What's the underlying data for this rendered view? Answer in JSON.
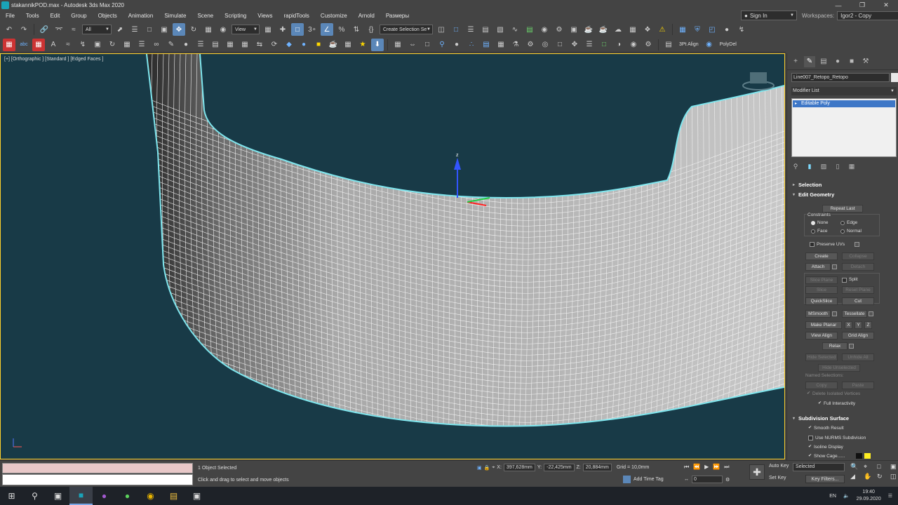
{
  "window": {
    "title": "stakannikPOD.max - Autodesk 3ds Max 2020",
    "controls": [
      "—",
      "❐",
      "✕"
    ]
  },
  "menu": [
    "File",
    "Tools",
    "Edit",
    "Group",
    "Objects",
    "Animation",
    "Simulate",
    "Scene",
    "Scripting",
    "Views",
    "rapidTools",
    "Customize",
    "Arnold",
    "Размеры"
  ],
  "account": {
    "signin": "Sign In",
    "workspaces_label": "Workspaces:",
    "workspace_value": "Igor2 - Copy"
  },
  "toolbar1": {
    "selection_filter": "All",
    "ref_coord": "View",
    "named_selection": "Create Selection Se"
  },
  "toolbar2": {
    "label_3pt": "3Pt Align",
    "label_polydel": "PolyDel"
  },
  "viewport": {
    "label": "[+] [Orthographic ] [Standard ] [Edged Faces ]",
    "gizmo_axis": "z"
  },
  "panel": {
    "object_name": "Line007_Retopo_Retopo",
    "modifier_list": "Modifier List",
    "stack_item": "Editable Poly",
    "rollouts": {
      "selection": "Selection",
      "edit_geometry": "Edit Geometry",
      "subdivision_surface": "Subdivision Surface"
    },
    "edit_geometry": {
      "repeat_last": "Repeat Last",
      "constraints": "Constraints",
      "none": "None",
      "edge": "Edge",
      "face": "Face",
      "normal": "Normal",
      "preserve_uvs": "Preserve UVs",
      "create": "Create",
      "collapse": "Collapse",
      "attach": "Attach",
      "detach": "Detach",
      "slice_plane": "Slice Plane",
      "split": "Split",
      "slice": "Slice",
      "reset_plane": "Reset Plane",
      "quickslice": "QuickSlice",
      "cut": "Cut",
      "msmooth": "MSmooth",
      "tessellate": "Tessellate",
      "make_planar": "Make Planar",
      "x": "X",
      "y": "Y",
      "z": "Z",
      "view_align": "View Align",
      "grid_align": "Grid Align",
      "relax": "Relax",
      "hide_selected": "Hide Selected",
      "unhide_all": "Unhide All",
      "hide_unselected": "Hide Unselected",
      "named_selections": "Named Selections:",
      "copy": "Copy",
      "paste": "Paste",
      "delete_isolated": "Delete Isolated Vertices",
      "full_interactivity": "Full Interactivity"
    },
    "subdivision": {
      "smooth_result": "Smooth Result",
      "use_nurms": "Use NURMS Subdivision",
      "isoline_display": "Isoline Display",
      "show_cage": "Show Cage......"
    }
  },
  "status": {
    "selected": "1 Object Selected",
    "prompt": "Click and drag to select and move objects",
    "x_label": "X:",
    "x": "397,628mm",
    "y_label": "Y:",
    "y": "-22,425mm",
    "z_label": "Z:",
    "z": "20,884mm",
    "grid": "Grid = 10,0mm",
    "add_time_tag": "Add Time Tag",
    "frame": "0",
    "auto_key": "Auto Key",
    "set_key": "Set Key",
    "selected_drop": "Selected",
    "key_filters": "Key Filters..."
  },
  "taskbar": {
    "lang": "EN",
    "time": "19:40",
    "date": "29.09.2020"
  },
  "colors": {
    "viewport_bg": "#183a47",
    "selection_outline": "#7fe6ee",
    "stack_highlight": "#3e77c7",
    "active_border": "#ffd12b"
  }
}
